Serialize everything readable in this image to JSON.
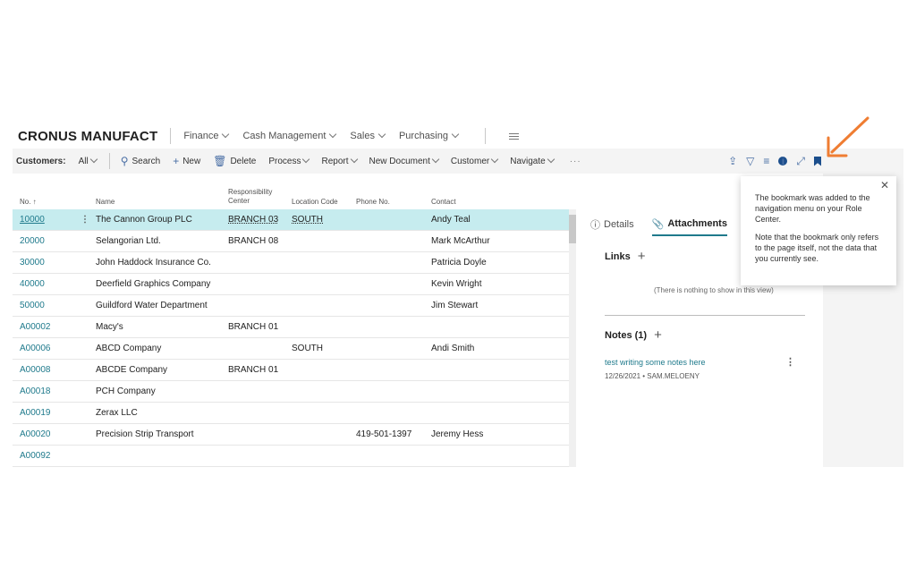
{
  "nav": {
    "company": "CRONUS MANUFACT",
    "items": [
      "Finance",
      "Cash Management",
      "Sales",
      "Purchasing"
    ]
  },
  "actionbar": {
    "title": "Customers:",
    "filter": "All",
    "search": "Search",
    "new": "New",
    "delete": "Delete",
    "process": "Process",
    "report": "Report",
    "new_document": "New Document",
    "customer": "Customer",
    "navigate": "Navigate",
    "more": "···"
  },
  "grid": {
    "headers": {
      "no": "No. ↑",
      "name": "Name",
      "resp": "Responsibility Center",
      "loc": "Location Code",
      "phone": "Phone No.",
      "contact": "Contact"
    },
    "rows": [
      {
        "no": "10000",
        "name": "The Cannon Group PLC",
        "resp": "BRANCH 03",
        "loc": "SOUTH",
        "phone": "",
        "contact": "Andy Teal"
      },
      {
        "no": "20000",
        "name": "Selangorian Ltd.",
        "resp": "BRANCH 08",
        "loc": "",
        "phone": "",
        "contact": "Mark McArthur"
      },
      {
        "no": "30000",
        "name": "John Haddock Insurance Co.",
        "resp": "",
        "loc": "",
        "phone": "",
        "contact": "Patricia Doyle"
      },
      {
        "no": "40000",
        "name": "Deerfield Graphics Company",
        "resp": "",
        "loc": "",
        "phone": "",
        "contact": "Kevin Wright"
      },
      {
        "no": "50000",
        "name": "Guildford Water Department",
        "resp": "",
        "loc": "",
        "phone": "",
        "contact": "Jim Stewart"
      },
      {
        "no": "A00002",
        "name": "Macy's",
        "resp": "BRANCH 01",
        "loc": "",
        "phone": "",
        "contact": ""
      },
      {
        "no": "A00006",
        "name": "ABCD Company",
        "resp": "",
        "loc": "SOUTH",
        "phone": "",
        "contact": "Andi Smith"
      },
      {
        "no": "A00008",
        "name": "ABCDE Company",
        "resp": "BRANCH 01",
        "loc": "",
        "phone": "",
        "contact": ""
      },
      {
        "no": "A00018",
        "name": "PCH Company",
        "resp": "",
        "loc": "",
        "phone": "",
        "contact": ""
      },
      {
        "no": "A00019",
        "name": "Zerax LLC",
        "resp": "",
        "loc": "",
        "phone": "",
        "contact": ""
      },
      {
        "no": "A00020",
        "name": "Precision Strip Transport",
        "resp": "",
        "loc": "",
        "phone": "419-501-1397",
        "contact": "Jeremy Hess"
      },
      {
        "no": "A00092",
        "name": "",
        "resp": "",
        "loc": "",
        "phone": "",
        "contact": ""
      }
    ]
  },
  "factbox": {
    "tab_details": "Details",
    "tab_attachments": "Attachments",
    "links": "Links",
    "empty": "(There is nothing to show in this view)",
    "notes": "Notes (1)",
    "note_text": "test writing some notes here",
    "note_meta": "12/26/2021 • SAM.MELOENY"
  },
  "popup": {
    "line1": "The bookmark was added to the navigation menu on your Role Center.",
    "line2": "Note that the bookmark only refers to the page itself, not the data that you currently see."
  },
  "colors": {
    "accent": "#1f7a8c",
    "selected_row": "#c6ecef",
    "arrow": "#ef7d32"
  }
}
